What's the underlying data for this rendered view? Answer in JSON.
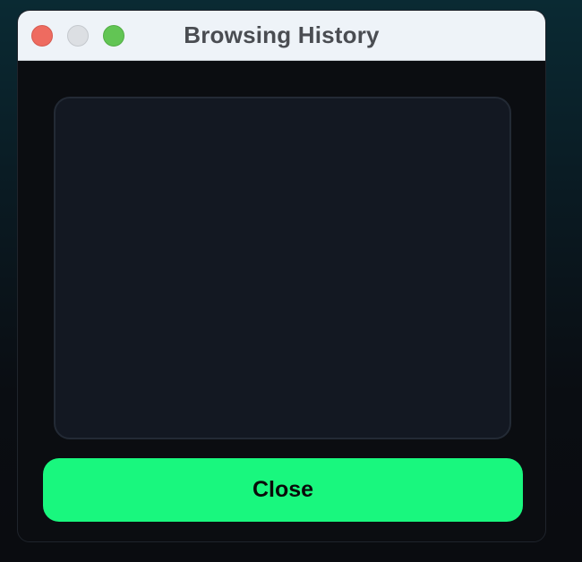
{
  "window": {
    "title": "Browsing History"
  },
  "traffic_lights": {
    "close_color": "#ee6b60",
    "minimize_color": "#dcdfe3",
    "maximize_color": "#62c554"
  },
  "history_panel": {
    "items": []
  },
  "footer": {
    "close_label": "Close",
    "accent_color": "#19f77e"
  }
}
